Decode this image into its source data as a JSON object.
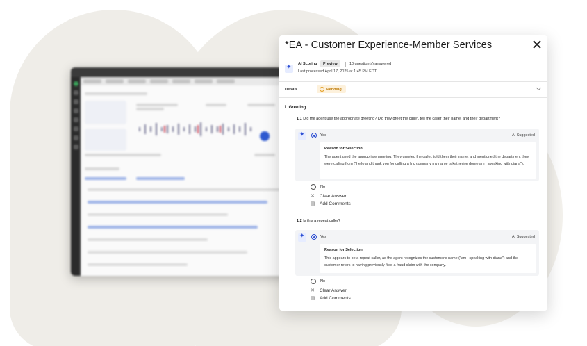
{
  "modal": {
    "title": "*EA - Customer Experience-Member Services",
    "ai_scoring_label": "AI Scoring",
    "preview_badge": "Preview",
    "questions_answered": "10 question(s) answered",
    "last_processed": "Last processed April 17, 2025 at 1:45 PM EDT",
    "details_label": "Details",
    "status": "Pending",
    "section_title": "1. Greeting",
    "questions": [
      {
        "number": "1.1",
        "text": "Did the agent use the appropriate greeting? Did they greet the caller, tell the caller their name, and their department?",
        "selected": "Yes",
        "ai_suggested": "AI Suggested",
        "reason_title": "Reason for Selection",
        "reason": "The agent used the appropriate greeting. They greeted the caller, told them their name, and mentioned the department they were calling from (\"hello and thank you for calling a b c company my name is katherine dome am i speaking with diana\").",
        "other_option": "No",
        "clear_answer": "Clear Answer",
        "add_comments": "Add Comments"
      },
      {
        "number": "1.2",
        "text": "Is this a repeat caller?",
        "selected": "Yes",
        "ai_suggested": "AI Suggested",
        "reason_title": "Reason for Selection",
        "reason": "This appears to be a repeat caller, as the agent recognizes the customer's name (\"am i speaking with diana\") and the customer refers to having previously filed a fraud claim with the company.",
        "other_option": "No",
        "clear_answer": "Clear Answer",
        "add_comments": "Add Comments"
      }
    ]
  },
  "icons": {
    "close": "close-icon",
    "ai": "sparkle-icon",
    "pending": "circle-icon",
    "clear": "x-icon",
    "comment": "comment-icon",
    "expand": "chevron-down-icon"
  },
  "colors": {
    "accent": "#2d4fd3",
    "pending": "#e29b1d",
    "pending_bg": "#fdf1dc",
    "answer_bg": "#f3f4f6",
    "backdrop": "#efede8"
  }
}
